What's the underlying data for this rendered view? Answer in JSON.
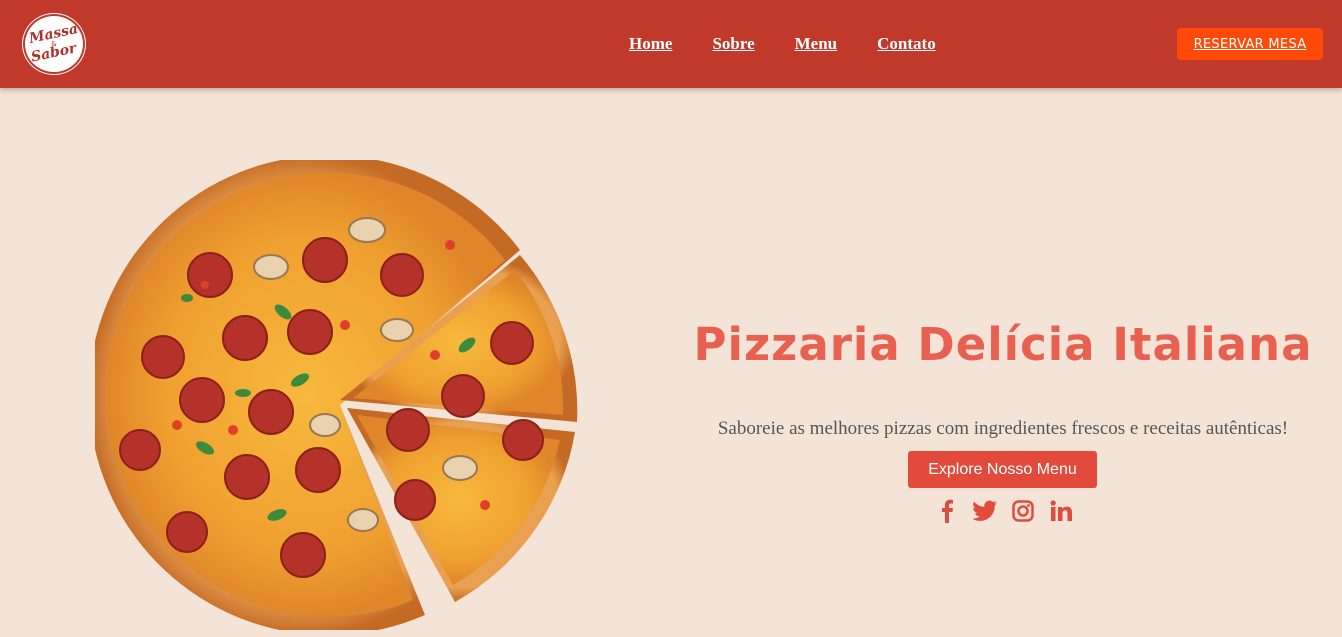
{
  "header": {
    "logo_line1": "Massa",
    "logo_amp": "&",
    "logo_line2": "Sabor",
    "nav": [
      "Home",
      "Sobre",
      "Menu",
      "Contato"
    ],
    "reserve_label": "RESERVAR MESA"
  },
  "hero": {
    "title": "Pizzaria Delícia Italiana",
    "subtitle": "Saboreie as melhores pizzas com ingredientes frescos e receitas autênticas!",
    "cta_label": "Explore Nosso Menu"
  },
  "social": [
    "facebook-icon",
    "twitter-icon",
    "instagram-icon",
    "linkedin-icon"
  ],
  "colors": {
    "header_bg": "#c0392b",
    "page_bg": "#f4e4d7",
    "accent": "#e24b3b",
    "reserve_bg": "#ff4a0a",
    "title": "#e8604f"
  }
}
